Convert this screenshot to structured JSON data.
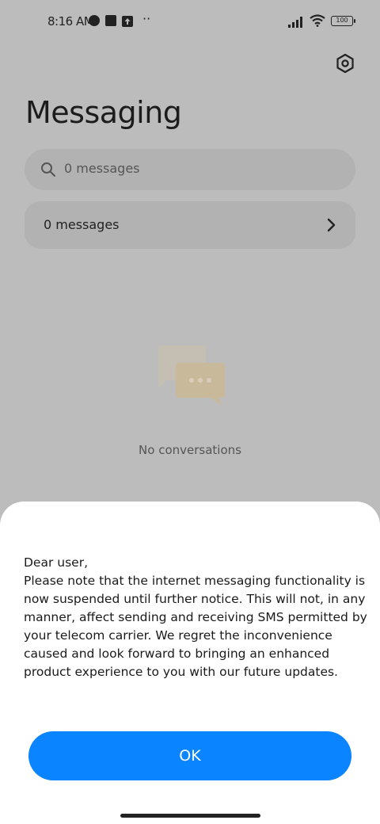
{
  "status_bar": {
    "time": "8:16 AM",
    "more": "··",
    "battery": "100",
    "icons": [
      "data-saver-icon",
      "square-notification-icon",
      "upload-icon",
      "signal-icon",
      "wifi-icon",
      "battery-icon"
    ]
  },
  "header": {
    "title": "Messaging",
    "settings_icon": "gear-icon"
  },
  "search": {
    "placeholder": "0 messages",
    "icon": "search-icon"
  },
  "messages_row": {
    "label": "0 messages",
    "icon": "chevron-right-icon"
  },
  "empty_state": {
    "icon": "chat-bubbles-icon",
    "text": "No conversations"
  },
  "dialog": {
    "message": "Dear user,\nPlease note that the internet messaging functionality is now suspended until further notice. This will not, in any manner, affect sending and receiving SMS permitted by your telecom carrier. We regret the inconvenience caused and look forward to bringing an enhanced product experience to you with our future updates.",
    "ok_label": "OK"
  },
  "colors": {
    "accent": "#0a84ff",
    "overlay_background": "#bcbcbc",
    "sheet": "#ffffff"
  }
}
